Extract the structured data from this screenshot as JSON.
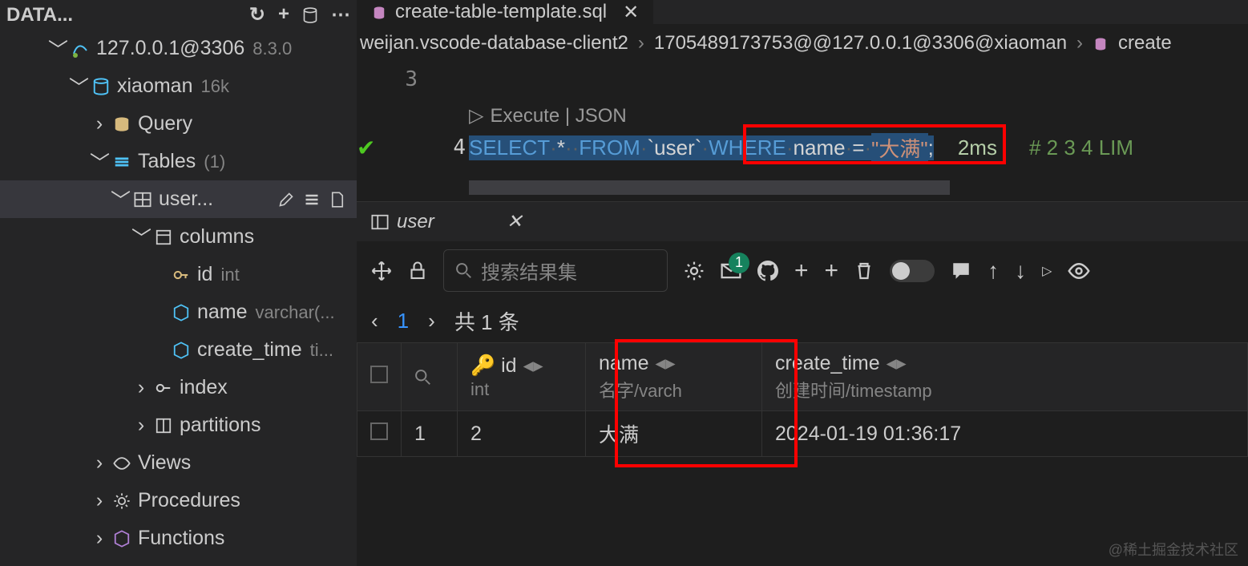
{
  "sidebar": {
    "header": "DATA...",
    "connection": {
      "host": "127.0.0.1@3306",
      "version": "8.3.0"
    },
    "database": {
      "name": "xiaoman",
      "count": "16k"
    },
    "nodes": {
      "query": "Query",
      "tables": "Tables",
      "tables_count": "(1)",
      "user_table": "user...",
      "columns": "columns",
      "col_id": "id",
      "col_id_type": "int",
      "col_name": "name",
      "col_name_type": "varchar(...",
      "col_ct": "create_time",
      "col_ct_type": "ti...",
      "index": "index",
      "partitions": "partitions",
      "views": "Views",
      "procedures": "Procedures",
      "functions": "Functions"
    }
  },
  "tab": {
    "title": "create-table-template.sql"
  },
  "breadcrumb": {
    "p1": "weijan.vscode-database-client2",
    "p2": "1705489173753@@127.0.0.1@3306@xiaoman",
    "p3": "create"
  },
  "editor": {
    "line3": "3",
    "line4": "4",
    "codelens": "Execute | JSON",
    "sql": {
      "select": "SELECT",
      "star": "*",
      "from": "FROM",
      "table": "`user`",
      "where": "WHERE",
      "col": "name",
      "eq": "=",
      "val": "\"大满\"",
      "semi": ";"
    },
    "time": "2ms",
    "comment": "# 2 3 4   LIM"
  },
  "result": {
    "tab": "user",
    "search_placeholder": "搜索结果集",
    "mail_badge": "1",
    "page": "1",
    "total": "共 1 条",
    "headers": {
      "id": "id",
      "id_sub": "int",
      "name": "name",
      "name_sub": "名字/varch",
      "ct": "create_time",
      "ct_sub": "创建时间/timestamp"
    },
    "row": {
      "num": "1",
      "id": "2",
      "name": "大满",
      "ct": "2024-01-19 01:36:17"
    }
  },
  "watermark": "@稀土掘金技术社区"
}
